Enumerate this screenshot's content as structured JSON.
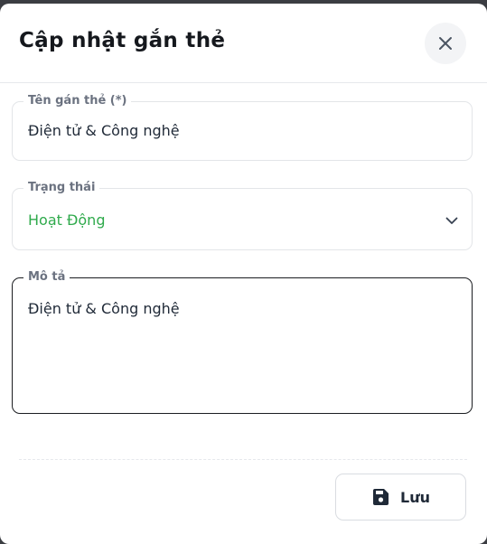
{
  "modal": {
    "title": "Cập nhật gắn thẻ",
    "close_icon": "close-icon"
  },
  "form": {
    "tag_name": {
      "label": "Tên gán thẻ (*)",
      "value": "Điện tử & Công nghệ"
    },
    "status": {
      "label": "Trạng thái",
      "value": "Hoạt Động",
      "value_color": "#2faa4c",
      "icon": "chevron-down-icon"
    },
    "description": {
      "label": "Mô tả",
      "value": "Điện tử & Công nghệ"
    }
  },
  "footer": {
    "save_label": "Lưu",
    "save_icon": "floppy-disk-icon"
  }
}
